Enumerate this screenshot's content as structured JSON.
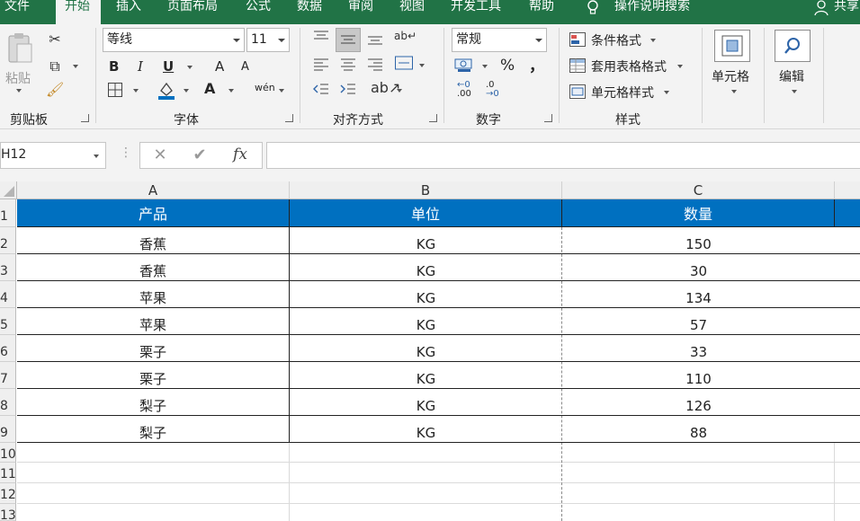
{
  "ribbon_tabs": [
    "文件",
    "开始",
    "插入",
    "页面布局",
    "公式",
    "数据",
    "审阅",
    "视图",
    "开发工具",
    "帮助"
  ],
  "tell_me": "操作说明搜索",
  "share": "共享",
  "clipboard": {
    "paste": "粘贴",
    "group": "剪贴板"
  },
  "font": {
    "name": "等线",
    "size": "11",
    "bold": "B",
    "italic": "I",
    "underline": "U",
    "grow": "A",
    "shrink": "A",
    "color_a": "A",
    "phonetic": "wén",
    "group": "字体"
  },
  "alignment": {
    "group": "对齐方式"
  },
  "number": {
    "format": "常规",
    "percent": "%",
    "comma": "，",
    "inc_decimal": ".00",
    "dec_decimal": ".0",
    "group": "数字"
  },
  "styles": {
    "conditional": "条件格式",
    "table": "套用表格格式",
    "cell": "单元格样式",
    "group": "样式"
  },
  "cells": {
    "label": "单元格"
  },
  "editing": {
    "label": "编辑"
  },
  "name_box": "H12",
  "formula_value": "",
  "columns": [
    "A",
    "B",
    "C"
  ],
  "row_numbers": [
    "1",
    "2",
    "3",
    "4",
    "5",
    "6",
    "7",
    "8",
    "9",
    "10",
    "11",
    "12",
    "13"
  ],
  "table": {
    "headers": [
      "产品",
      "单位",
      "数量"
    ],
    "rows": [
      [
        "香蕉",
        "KG",
        "150"
      ],
      [
        "香蕉",
        "KG",
        "30"
      ],
      [
        "苹果",
        "KG",
        "134"
      ],
      [
        "苹果",
        "KG",
        "57"
      ],
      [
        "栗子",
        "KG",
        "33"
      ],
      [
        "栗子",
        "KG",
        "110"
      ],
      [
        "梨子",
        "KG",
        "126"
      ],
      [
        "梨子",
        "KG",
        "88"
      ]
    ]
  },
  "colors": {
    "title_bar": "#217346",
    "header_fill": "#0070c0",
    "header_text": "#ffffff"
  }
}
